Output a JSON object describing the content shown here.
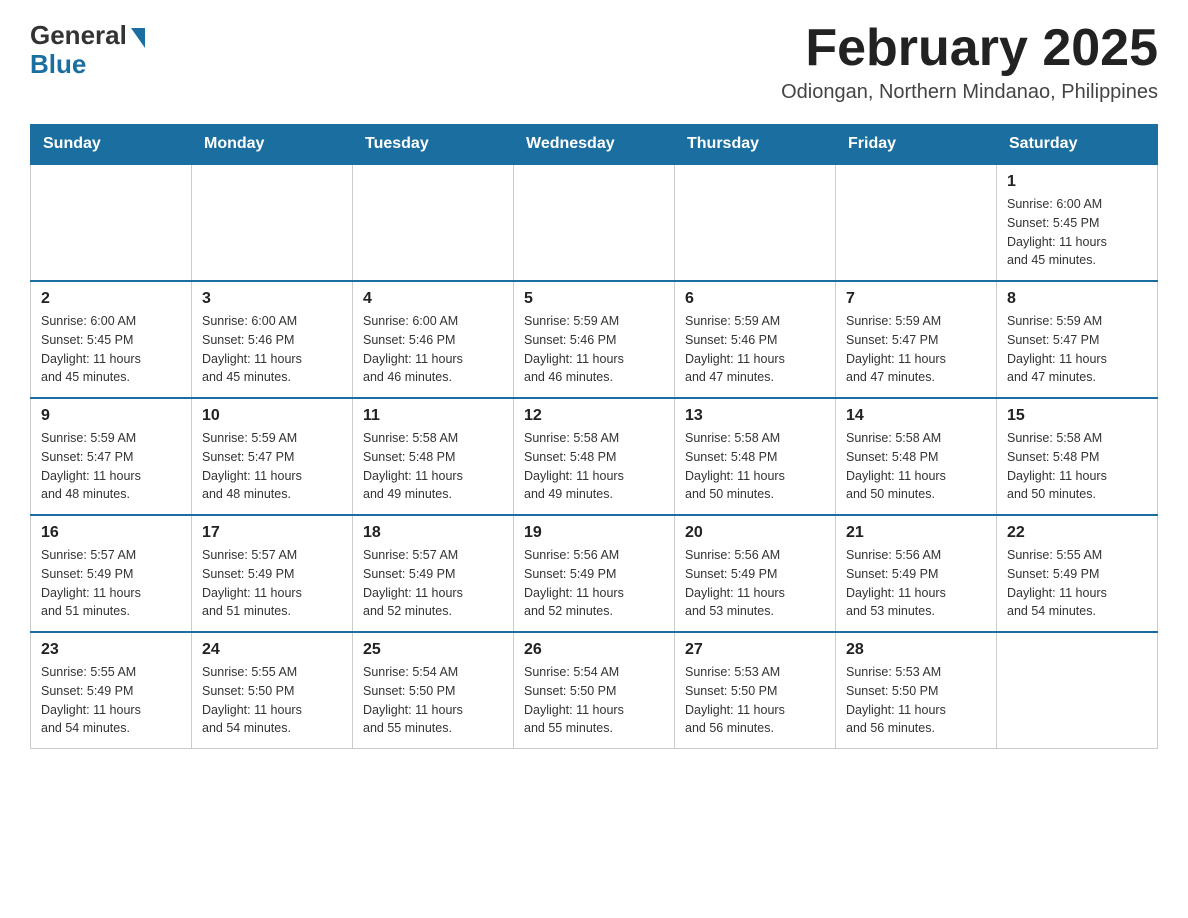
{
  "logo": {
    "general": "General",
    "blue": "Blue"
  },
  "header": {
    "title": "February 2025",
    "subtitle": "Odiongan, Northern Mindanao, Philippines"
  },
  "days_of_week": [
    "Sunday",
    "Monday",
    "Tuesday",
    "Wednesday",
    "Thursday",
    "Friday",
    "Saturday"
  ],
  "weeks": [
    {
      "days": [
        {
          "num": "",
          "info": ""
        },
        {
          "num": "",
          "info": ""
        },
        {
          "num": "",
          "info": ""
        },
        {
          "num": "",
          "info": ""
        },
        {
          "num": "",
          "info": ""
        },
        {
          "num": "",
          "info": ""
        },
        {
          "num": "1",
          "info": "Sunrise: 6:00 AM\nSunset: 5:45 PM\nDaylight: 11 hours\nand 45 minutes."
        }
      ]
    },
    {
      "days": [
        {
          "num": "2",
          "info": "Sunrise: 6:00 AM\nSunset: 5:45 PM\nDaylight: 11 hours\nand 45 minutes."
        },
        {
          "num": "3",
          "info": "Sunrise: 6:00 AM\nSunset: 5:46 PM\nDaylight: 11 hours\nand 45 minutes."
        },
        {
          "num": "4",
          "info": "Sunrise: 6:00 AM\nSunset: 5:46 PM\nDaylight: 11 hours\nand 46 minutes."
        },
        {
          "num": "5",
          "info": "Sunrise: 5:59 AM\nSunset: 5:46 PM\nDaylight: 11 hours\nand 46 minutes."
        },
        {
          "num": "6",
          "info": "Sunrise: 5:59 AM\nSunset: 5:46 PM\nDaylight: 11 hours\nand 47 minutes."
        },
        {
          "num": "7",
          "info": "Sunrise: 5:59 AM\nSunset: 5:47 PM\nDaylight: 11 hours\nand 47 minutes."
        },
        {
          "num": "8",
          "info": "Sunrise: 5:59 AM\nSunset: 5:47 PM\nDaylight: 11 hours\nand 47 minutes."
        }
      ]
    },
    {
      "days": [
        {
          "num": "9",
          "info": "Sunrise: 5:59 AM\nSunset: 5:47 PM\nDaylight: 11 hours\nand 48 minutes."
        },
        {
          "num": "10",
          "info": "Sunrise: 5:59 AM\nSunset: 5:47 PM\nDaylight: 11 hours\nand 48 minutes."
        },
        {
          "num": "11",
          "info": "Sunrise: 5:58 AM\nSunset: 5:48 PM\nDaylight: 11 hours\nand 49 minutes."
        },
        {
          "num": "12",
          "info": "Sunrise: 5:58 AM\nSunset: 5:48 PM\nDaylight: 11 hours\nand 49 minutes."
        },
        {
          "num": "13",
          "info": "Sunrise: 5:58 AM\nSunset: 5:48 PM\nDaylight: 11 hours\nand 50 minutes."
        },
        {
          "num": "14",
          "info": "Sunrise: 5:58 AM\nSunset: 5:48 PM\nDaylight: 11 hours\nand 50 minutes."
        },
        {
          "num": "15",
          "info": "Sunrise: 5:58 AM\nSunset: 5:48 PM\nDaylight: 11 hours\nand 50 minutes."
        }
      ]
    },
    {
      "days": [
        {
          "num": "16",
          "info": "Sunrise: 5:57 AM\nSunset: 5:49 PM\nDaylight: 11 hours\nand 51 minutes."
        },
        {
          "num": "17",
          "info": "Sunrise: 5:57 AM\nSunset: 5:49 PM\nDaylight: 11 hours\nand 51 minutes."
        },
        {
          "num": "18",
          "info": "Sunrise: 5:57 AM\nSunset: 5:49 PM\nDaylight: 11 hours\nand 52 minutes."
        },
        {
          "num": "19",
          "info": "Sunrise: 5:56 AM\nSunset: 5:49 PM\nDaylight: 11 hours\nand 52 minutes."
        },
        {
          "num": "20",
          "info": "Sunrise: 5:56 AM\nSunset: 5:49 PM\nDaylight: 11 hours\nand 53 minutes."
        },
        {
          "num": "21",
          "info": "Sunrise: 5:56 AM\nSunset: 5:49 PM\nDaylight: 11 hours\nand 53 minutes."
        },
        {
          "num": "22",
          "info": "Sunrise: 5:55 AM\nSunset: 5:49 PM\nDaylight: 11 hours\nand 54 minutes."
        }
      ]
    },
    {
      "days": [
        {
          "num": "23",
          "info": "Sunrise: 5:55 AM\nSunset: 5:49 PM\nDaylight: 11 hours\nand 54 minutes."
        },
        {
          "num": "24",
          "info": "Sunrise: 5:55 AM\nSunset: 5:50 PM\nDaylight: 11 hours\nand 54 minutes."
        },
        {
          "num": "25",
          "info": "Sunrise: 5:54 AM\nSunset: 5:50 PM\nDaylight: 11 hours\nand 55 minutes."
        },
        {
          "num": "26",
          "info": "Sunrise: 5:54 AM\nSunset: 5:50 PM\nDaylight: 11 hours\nand 55 minutes."
        },
        {
          "num": "27",
          "info": "Sunrise: 5:53 AM\nSunset: 5:50 PM\nDaylight: 11 hours\nand 56 minutes."
        },
        {
          "num": "28",
          "info": "Sunrise: 5:53 AM\nSunset: 5:50 PM\nDaylight: 11 hours\nand 56 minutes."
        },
        {
          "num": "",
          "info": ""
        }
      ]
    }
  ]
}
